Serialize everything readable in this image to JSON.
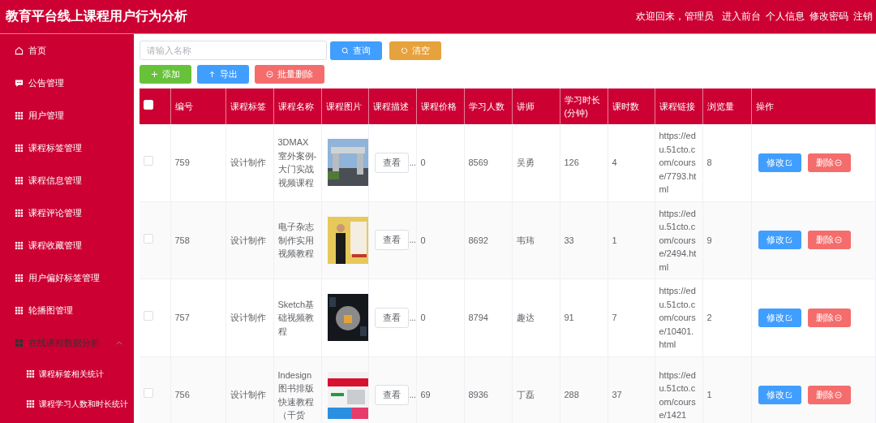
{
  "header": {
    "title": "教育平台线上课程用户行为分析",
    "welcome": "欢迎回来，管理员",
    "links": [
      "进入前台",
      "个人信息",
      "修改密码",
      "注销"
    ]
  },
  "sidebar": {
    "items": [
      {
        "kind": "home",
        "label": "首页",
        "expanded": false
      },
      {
        "kind": "chat",
        "label": "公告管理",
        "expanded": false
      },
      {
        "kind": "grid",
        "label": "用户管理",
        "expanded": false
      },
      {
        "kind": "grid",
        "label": "课程标签管理",
        "expanded": false
      },
      {
        "kind": "grid",
        "label": "课程信息管理",
        "expanded": false
      },
      {
        "kind": "grid",
        "label": "课程评论管理",
        "expanded": false
      },
      {
        "kind": "grid",
        "label": "课程收藏管理",
        "expanded": false
      },
      {
        "kind": "grid",
        "label": "用户偏好标签管理",
        "expanded": false
      },
      {
        "kind": "grid",
        "label": "轮播图管理",
        "expanded": false
      },
      {
        "kind": "group",
        "label": "在线课程数据分析",
        "expanded": true,
        "children": [
          {
            "label": "课程标签相关统计"
          },
          {
            "label": "课程学习人数和时长统计"
          }
        ]
      }
    ]
  },
  "search": {
    "placeholder": "请输入名称"
  },
  "toolbar": [
    [
      {
        "kind": "search",
        "label": "查询"
      },
      {
        "kind": "reset",
        "label": "清空"
      }
    ],
    [
      {
        "kind": "add",
        "label": "添加"
      },
      {
        "kind": "export",
        "label": "导出"
      },
      {
        "kind": "batch-delete",
        "label": "批量删除"
      }
    ]
  ],
  "table": {
    "select_all_checked": false,
    "columns": [
      "编号",
      "课程标签",
      "课程名称",
      "课程图片",
      "课程描述",
      "课程价格",
      "学习人数",
      "讲师",
      "学习时长(分钟)",
      "课时数",
      "课程链接",
      "浏览量",
      "操作"
    ],
    "rows": [
      {
        "checked": false,
        "id": "759",
        "tag": "设计制作",
        "name": "3DMAX室外案例-大门实战视频课程",
        "describe": "查看",
        "more": "...",
        "price": "0",
        "learners": "8569",
        "teacher": "吴勇",
        "minutes": "126",
        "lessons": "4",
        "link": "https://edu.51cto.com/course/7793.html",
        "views": "8",
        "edit": "修改",
        "delete": "删除"
      },
      {
        "checked": false,
        "id": "758",
        "tag": "设计制作",
        "name": "电子杂志制作实用视频教程",
        "describe": "查看",
        "more": "...",
        "price": "0",
        "learners": "8692",
        "teacher": "韦玮",
        "minutes": "33",
        "lessons": "1",
        "link": "https://edu.51cto.com/course/2494.html",
        "views": "9",
        "edit": "修改",
        "delete": "删除"
      },
      {
        "checked": false,
        "id": "757",
        "tag": "设计制作",
        "name": "Sketch基础视频教程",
        "describe": "查看",
        "more": "...",
        "price": "0",
        "learners": "8794",
        "teacher": "趣达",
        "minutes": "91",
        "lessons": "7",
        "link": "https://edu.51cto.com/course/10401.html",
        "views": "2",
        "edit": "修改",
        "delete": "删除"
      },
      {
        "checked": false,
        "id": "756",
        "tag": "设计制作",
        "name": "Indesign图书排版快速教程（干货",
        "describe": "查看",
        "more": "...",
        "price": "69",
        "learners": "8936",
        "teacher": "丁磊",
        "minutes": "288",
        "lessons": "37",
        "link": "https://edu.51cto.com/course/1421",
        "views": "1",
        "edit": "修改",
        "delete": "删除"
      }
    ]
  }
}
